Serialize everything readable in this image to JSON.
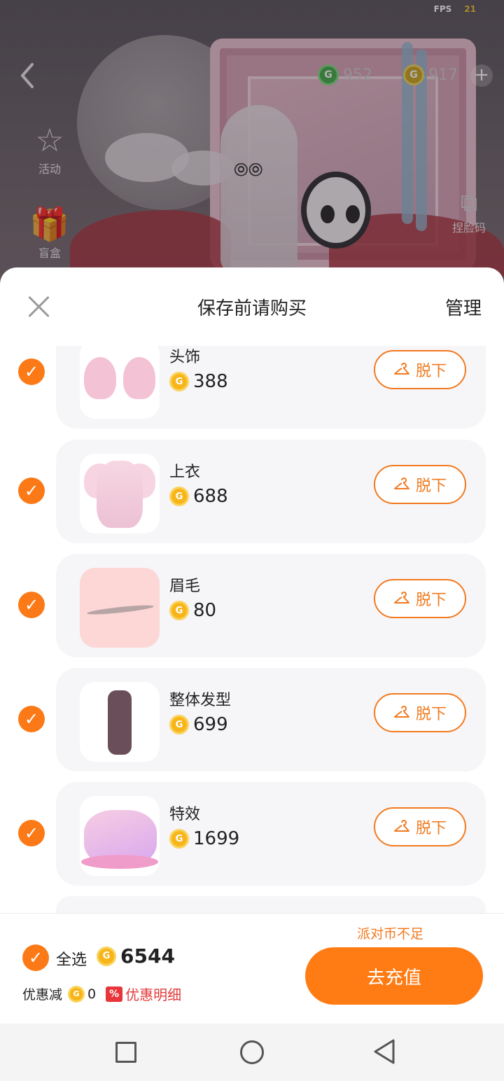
{
  "hud": {
    "fps_label": "FPS",
    "fps_value": "21",
    "green_currency": "952",
    "gold_currency": "917",
    "side_left": [
      {
        "label": "活动",
        "icon": "star-icon"
      },
      {
        "label": "盲盒",
        "icon": "gift-box-icon"
      }
    ],
    "side_right": [
      {
        "label": "捏脸码",
        "icon": "face-code-icon"
      }
    ]
  },
  "sheet": {
    "title": "保存前请购买",
    "manage_label": "管理",
    "takeoff_label": "脱下",
    "items": [
      {
        "name": "头饰",
        "price": "388",
        "checked": true
      },
      {
        "name": "上衣",
        "price": "688",
        "checked": true
      },
      {
        "name": "眉毛",
        "price": "80",
        "checked": true
      },
      {
        "name": "整体发型",
        "price": "699",
        "checked": true
      },
      {
        "name": "特效",
        "price": "1699",
        "checked": true
      }
    ]
  },
  "footer": {
    "select_all_label": "全选",
    "total": "6544",
    "discount_label": "优惠减",
    "discount_value": "0",
    "discount_badge": "%",
    "discount_detail_label": "优惠明细",
    "insufficient_label": "派对币不足",
    "recharge_label": "去充值"
  },
  "colors": {
    "accent": "#ff7b14",
    "coin_gold": "#f7b51a",
    "card_bg": "#f6f5f8",
    "discount_red": "#e23b3b"
  }
}
